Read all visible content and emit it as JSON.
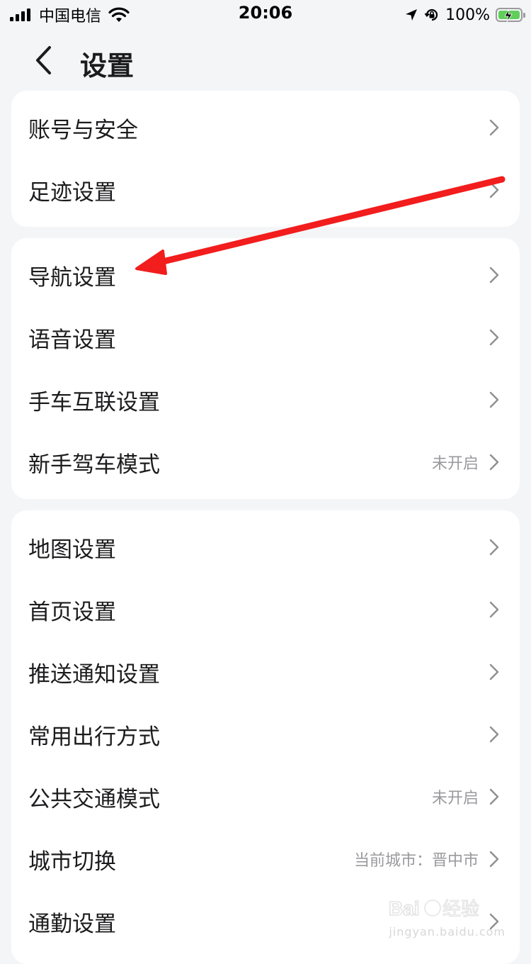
{
  "status_bar": {
    "carrier": "中国电信",
    "time": "20:06",
    "battery_percent": "100%",
    "battery_level": 1.0,
    "battery_charging": true
  },
  "header": {
    "back_icon": "chevron-left-icon",
    "title": "设置"
  },
  "groups": [
    {
      "items": [
        {
          "label": "账号与安全",
          "value": ""
        },
        {
          "label": "足迹设置",
          "value": ""
        }
      ]
    },
    {
      "items": [
        {
          "label": "导航设置",
          "value": ""
        },
        {
          "label": "语音设置",
          "value": ""
        },
        {
          "label": "手车互联设置",
          "value": ""
        },
        {
          "label": "新手驾车模式",
          "value": "未开启"
        }
      ]
    },
    {
      "items": [
        {
          "label": "地图设置",
          "value": ""
        },
        {
          "label": "首页设置",
          "value": ""
        },
        {
          "label": "推送通知设置",
          "value": ""
        },
        {
          "label": "常用出行方式",
          "value": ""
        },
        {
          "label": "公共交通模式",
          "value": "未开启"
        },
        {
          "label": "城市切换",
          "value": "当前城市：晋中市"
        },
        {
          "label": "通勤设置",
          "value": ""
        }
      ]
    }
  ],
  "annotation": {
    "arrow_color": "#f21d1d"
  },
  "watermark": {
    "logo_text": "Baidu经验",
    "sub_text": "jingyan.baidu.com"
  },
  "colors": {
    "background": "#f4f5f7",
    "card": "#ffffff",
    "text": "#1c1c1e",
    "secondary_text": "#9a9a9e",
    "chevron": "#8e8e93",
    "battery_fill": "#5fcf5a"
  }
}
